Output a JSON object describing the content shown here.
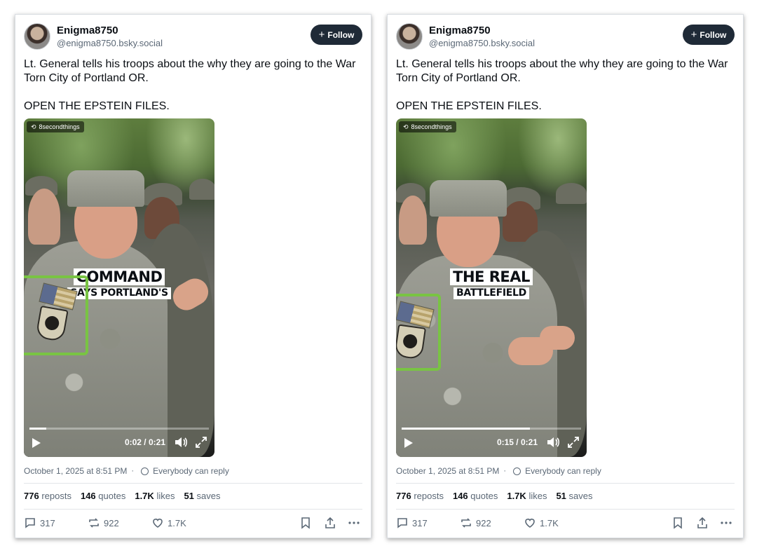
{
  "posts": [
    {
      "author": {
        "name": "Enigma8750",
        "handle": "@enigma8750.bsky.social"
      },
      "follow_label": "Follow",
      "text": [
        "Lt. General tells his troops about the why they are going to the War Torn City of Portland OR.",
        "OPEN THE EPSTEIN FILES."
      ],
      "video": {
        "source_tag": "8secondthings",
        "caption_line1": "COMMAND",
        "caption_line2": "SAYS PORTLAND'S",
        "time": "0:02 / 0:21",
        "progress": 0.095
      },
      "timestamp": "October 1, 2025 at 8:51 PM",
      "reply_setting": "Everybody can reply",
      "stats": {
        "reposts": "776",
        "reposts_label": "reposts",
        "quotes": "146",
        "quotes_label": "quotes",
        "likes": "1.7K",
        "likes_label": "likes",
        "saves": "51",
        "saves_label": "saves"
      },
      "actions": {
        "replies": "317",
        "reposts": "922",
        "likes": "1.7K"
      }
    },
    {
      "author": {
        "name": "Enigma8750",
        "handle": "@enigma8750.bsky.social"
      },
      "follow_label": "Follow",
      "text": [
        "Lt. General tells his troops about the why they are going to the War Torn City of Portland OR.",
        "OPEN THE EPSTEIN FILES."
      ],
      "video": {
        "source_tag": "8secondthings",
        "caption_line1": "THE REAL",
        "caption_line2": "BATTLEFIELD",
        "time": "0:15 / 0:21",
        "progress": 0.714
      },
      "timestamp": "October 1, 2025 at 8:51 PM",
      "reply_setting": "Everybody can reply",
      "stats": {
        "reposts": "776",
        "reposts_label": "reposts",
        "quotes": "146",
        "quotes_label": "quotes",
        "likes": "1.7K",
        "likes_label": "likes",
        "saves": "51",
        "saves_label": "saves"
      },
      "actions": {
        "replies": "317",
        "reposts": "922",
        "likes": "1.7K"
      }
    }
  ],
  "colors": {
    "highlight": "#79c443",
    "follow_bg": "#1f2a37",
    "muted": "#5b6876"
  },
  "icons": [
    "avatar",
    "plus-icon",
    "play-icon",
    "volume-icon",
    "fullscreen-icon",
    "globe-icon",
    "reply-icon",
    "repost-icon",
    "like-icon",
    "bookmark-icon",
    "share-icon",
    "more-icon"
  ]
}
